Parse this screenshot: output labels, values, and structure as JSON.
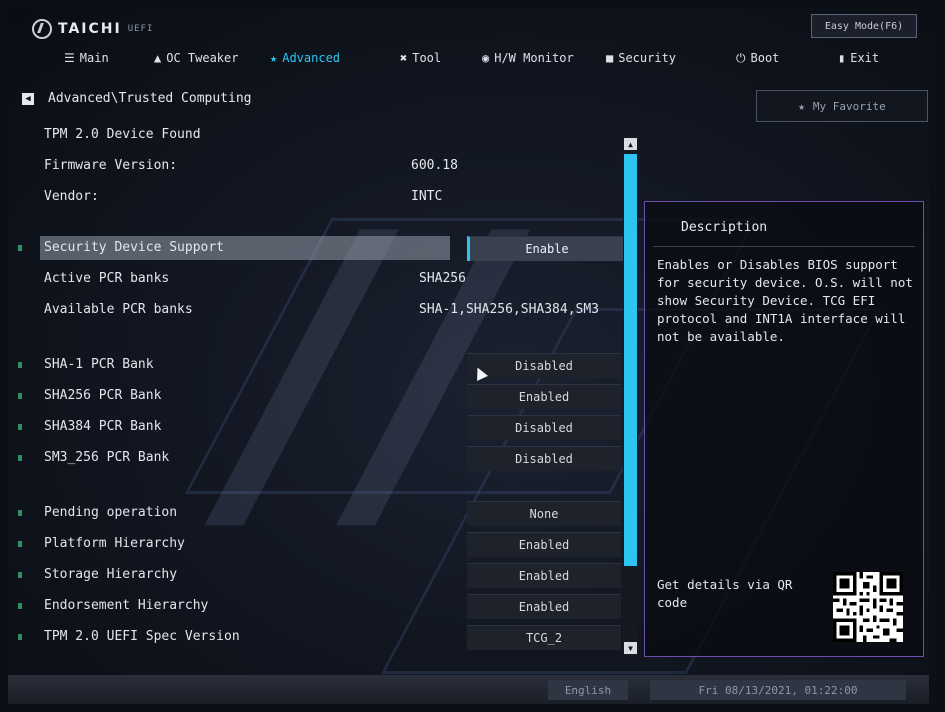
{
  "brand": {
    "name": "TAICHI",
    "suffix": "UEFI"
  },
  "easy_mode_label": "Easy Mode(F6)",
  "tabs": [
    {
      "label": "Main",
      "icon": "list-icon"
    },
    {
      "label": "OC Tweaker",
      "icon": "rocket-icon"
    },
    {
      "label": "Advanced",
      "icon": "star-icon"
    },
    {
      "label": "Tool",
      "icon": "tool-icon"
    },
    {
      "label": "H/W Monitor",
      "icon": "monitor-icon"
    },
    {
      "label": "Security",
      "icon": "shield-icon"
    },
    {
      "label": "Boot",
      "icon": "power-icon"
    },
    {
      "label": "Exit",
      "icon": "exit-icon"
    }
  ],
  "active_tab": "Advanced",
  "breadcrumb": "Advanced\\Trusted Computing",
  "favorite_label": "My Favorite",
  "info": {
    "found": "TPM 2.0 Device Found",
    "firmware_label": "Firmware Version:",
    "firmware_value": "600.18",
    "vendor_label": "Vendor:",
    "vendor_value": "INTC"
  },
  "settings": {
    "security_device_support": {
      "label": "Security Device Support",
      "value": "Enable"
    },
    "active_pcr_banks": {
      "label": "Active PCR banks",
      "value": "SHA256"
    },
    "available_pcr_banks": {
      "label": "Available PCR banks",
      "value": "SHA-1,SHA256,SHA384,SM3"
    },
    "sha1_pcr_bank": {
      "label": "SHA-1 PCR Bank",
      "value": "Disabled"
    },
    "sha256_pcr_bank": {
      "label": "SHA256 PCR Bank",
      "value": "Enabled"
    },
    "sha384_pcr_bank": {
      "label": "SHA384 PCR Bank",
      "value": "Disabled"
    },
    "sm3_256_pcr_bank": {
      "label": "SM3_256 PCR Bank",
      "value": "Disabled"
    },
    "pending_operation": {
      "label": "Pending operation",
      "value": "None"
    },
    "platform_hierarchy": {
      "label": "Platform Hierarchy",
      "value": "Enabled"
    },
    "storage_hierarchy": {
      "label": "Storage Hierarchy",
      "value": "Enabled"
    },
    "endorsement_hierarchy": {
      "label": "Endorsement Hierarchy",
      "value": "Enabled"
    },
    "tpm_uefi_spec_version": {
      "label": "TPM 2.0 UEFI Spec Version",
      "value": "TCG_2"
    }
  },
  "description": {
    "title": "Description",
    "body": "Enables or Disables BIOS support for security device. O.S. will not show Security Device. TCG EFI protocol and INT1A interface will not be available.",
    "qr_label": "Get details via QR code"
  },
  "footer": {
    "language": "English",
    "datetime": "Fri 08/13/2021, 01:22:00"
  },
  "colors": {
    "accent": "#2ec4f2",
    "panel_border": "#6d4fae",
    "bullet": "#2f8f63"
  }
}
